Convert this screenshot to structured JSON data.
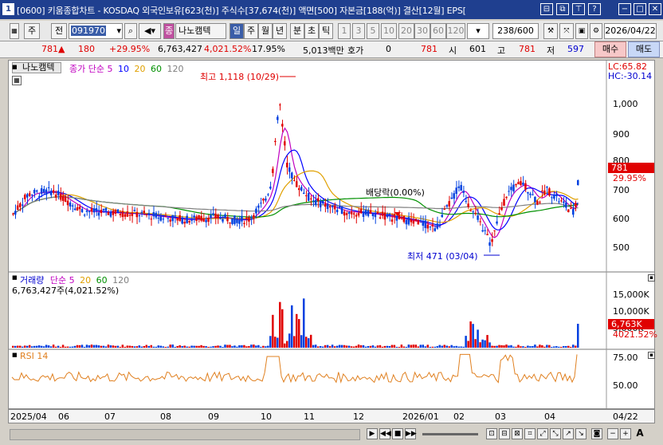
{
  "titlebar": {
    "window_num": "1",
    "title": "[0600] 키움종합차트 - KOSDAQ 외국인보유[623(천)] 주식수[37,674(천)] 액면[500] 자본금[188(억)] 결산[12월] EPS[",
    "buttons": [
      "⊟",
      "⧉",
      "⊤",
      "?",
      "−",
      "□",
      "✕"
    ]
  },
  "toolbar": {
    "period_btn": "주",
    "prev_btn": "전",
    "code": "091970",
    "stock_name": "나노캠텍",
    "prefix_mark": "종",
    "periods": [
      "일",
      "주",
      "월",
      "년",
      "분",
      "초",
      "틱"
    ],
    "active_period": "일",
    "numbers": [
      "1",
      "3",
      "5",
      "10",
      "20",
      "30",
      "60",
      "120"
    ],
    "count": "238/600",
    "date": "2026/04/22"
  },
  "quote": {
    "price": "781",
    "change": "180",
    "change_pct": "+29.95%",
    "volume": "6,763,427",
    "vol_ratio": "4,021.52%",
    "turnover": "17.95%",
    "amount": "5,013백만",
    "hoga_label": "호가",
    "hoga": "0",
    "hoga_price": "781",
    "open_label": "시",
    "open": "601",
    "high_label": "고",
    "high": "781",
    "low_label": "저",
    "low": "597",
    "buy": "매수",
    "sell": "매도"
  },
  "price_panel": {
    "name_tab": "나노캠텍",
    "legend_title": "종가 단순",
    "ma_periods": [
      "5",
      "10",
      "20",
      "60",
      "120"
    ],
    "ma_colors": [
      "#c000c0",
      "#0000ff",
      "#e0a000",
      "#009000",
      "#808080"
    ],
    "lc_label": "LC:65.82",
    "hc_label": "HC:-30.14",
    "y_ticks": [
      "1,000",
      "900",
      "800",
      "700",
      "600",
      "500"
    ],
    "current_price_tag": "781",
    "current_pct_tag": "29.95%",
    "high_annot": "최고 1,118 (10/29)",
    "low_annot": "최저 471 (03/04)",
    "dividend_annot": "배당락(0.00%)"
  },
  "volume_panel": {
    "legend": "거래량",
    "legend_ma": "단순 5",
    "ma_periods": [
      "20",
      "60",
      "120"
    ],
    "value_label": "6,763,427주(4,021.52%)",
    "y_ticks": [
      "15,000K",
      "10,000K",
      "5,000K"
    ],
    "current_tag": "6,763K",
    "current_pct": "4021.52%"
  },
  "rsi_panel": {
    "legend": "RSI 14",
    "y_ticks": [
      "75.00",
      "50.00"
    ]
  },
  "x_axis": [
    "2025/04",
    "06",
    "07",
    "08",
    "09",
    "10",
    "11",
    "12",
    "2026/01",
    "02",
    "03",
    "04",
    "04/22"
  ],
  "colors": {
    "up": "#e00000",
    "down": "#0040e0",
    "title_bg": "#1f3f8f"
  }
}
